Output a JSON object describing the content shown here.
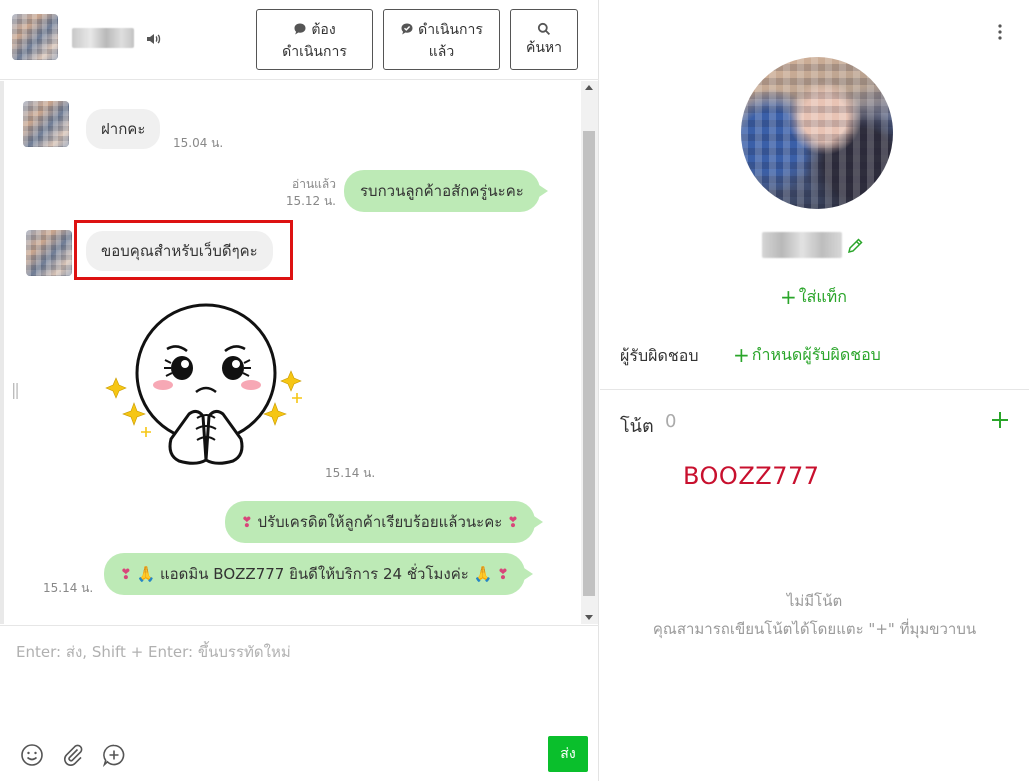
{
  "header": {
    "buttons": {
      "todo": "ต้อง\nดำเนินการ",
      "todo_line1": "ต้อง",
      "todo_line2": "ดำเนินการ",
      "done_line1": "ดำเนินการ",
      "done_line2": "แล้ว",
      "search": "ค้นหา"
    }
  },
  "messages": [
    {
      "id": "m1",
      "side": "in",
      "text": "ฝากคะ",
      "time": "15.04 น."
    },
    {
      "id": "m2",
      "side": "out",
      "text": "รบกวนลูกค้าอสักครู่นะคะ",
      "read": "อ่านแล้ว",
      "time": "15.12 น."
    },
    {
      "id": "m3",
      "side": "in",
      "text": "ขอบคุณสำหรับเว็บดีๆคะ",
      "highlighted": true
    },
    {
      "id": "m4",
      "side": "in",
      "type": "sticker",
      "time": "15.14 น."
    },
    {
      "id": "m5",
      "side": "out",
      "text": "ปรับเครดิตให้ลูกค้าเรียบร้อยแล้วนะคะ"
    },
    {
      "id": "m6",
      "side": "out",
      "text": "แอดมิน BOZZ777 ยินดีให้บริการ 24 ชั่วโมงค่ะ",
      "time": "15.14 น."
    }
  ],
  "composer": {
    "placeholder": "Enter: ส่ง, Shift + Enter: ขึ้นบรรทัดใหม่",
    "send_label": "ส่ง",
    "icons": [
      "emoji-icon",
      "attachment-icon",
      "add-circle-icon"
    ]
  },
  "profile": {
    "add_tag": "ใส่แท็ก",
    "assignee_label": "ผู้รับผิดชอบ",
    "assign_link": "กำหนดผู้รับผิดชอบ",
    "notes_title": "โน้ต",
    "notes_count": "0",
    "note_text": "BOOZZ777",
    "empty_title": "ไม่มีโน้ต",
    "empty_hint": "คุณสามารถเขียนโน้ตได้โดยแตะ \"+\" ที่มุมขวาบน"
  },
  "colors": {
    "accent_green": "#2aa52a",
    "send_button": "#0abf2c",
    "outgoing_bubble": "#bdeab6",
    "incoming_bubble": "#f0f0f0",
    "highlight_border": "#dd1111",
    "note_text": "#c8102e"
  }
}
